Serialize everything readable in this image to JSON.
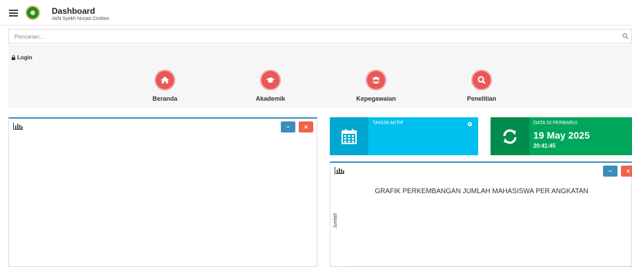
{
  "header": {
    "title": "Dashboard",
    "subtitle": "IAIN Syekh Nurjati Cirebon"
  },
  "search": {
    "placeholder": "Pencarian..."
  },
  "login": {
    "label": "Login"
  },
  "nav": [
    {
      "label": "Beranda",
      "icon": "home-icon"
    },
    {
      "label": "Akademik",
      "icon": "graduation-cap-icon"
    },
    {
      "label": "Kepegawaian",
      "icon": "users-icon"
    },
    {
      "label": "Penelitian",
      "icon": "search-icon"
    }
  ],
  "boxes": {
    "min_label": "−",
    "close_label": "×"
  },
  "info": {
    "tahun_aktif": {
      "label": "TAHUN AKTIF",
      "value": ""
    },
    "data_diperbarui": {
      "label": "DATA DI PERBARUI",
      "date": "19 May 2025",
      "time": "20:41:45"
    }
  },
  "chart_data": {
    "type": "bar",
    "title": "GRAFIK PERKEMBANGAN JUMLAH MAHASISWA PER ANGKATAN",
    "xlabel": "",
    "ylabel": "Jumlah",
    "categories": [],
    "series": []
  },
  "colors": {
    "accent": "#3c8dbc",
    "nav_circle": "#e95757",
    "info_blue": "#00c0ef",
    "info_green": "#00a65a",
    "danger": "#f06548"
  }
}
